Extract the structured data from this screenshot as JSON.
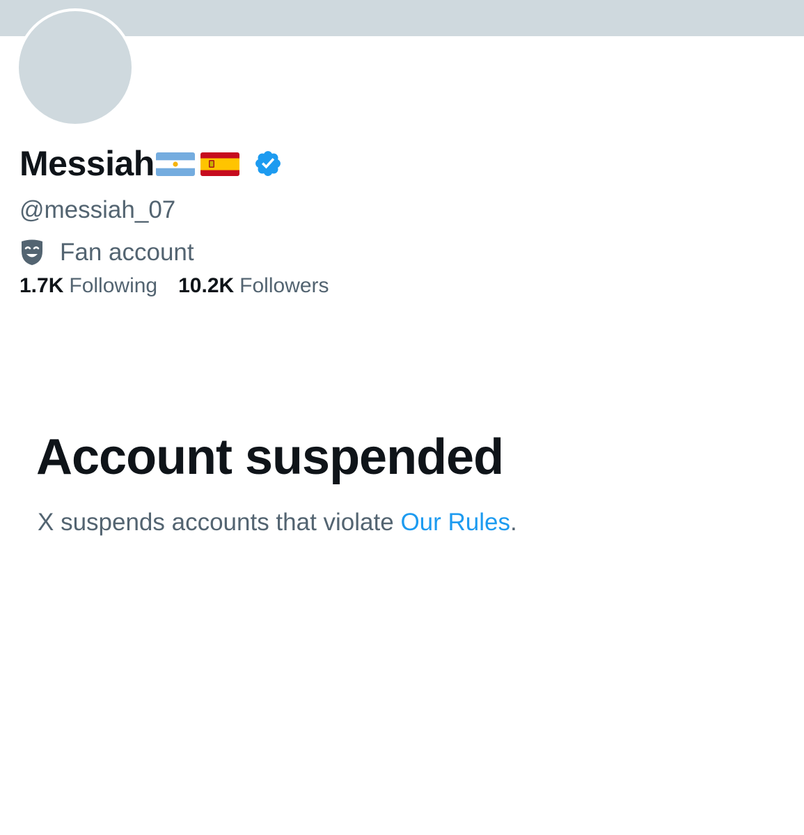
{
  "profile": {
    "display_name": "Messiah",
    "flags": [
      "argentina-flag",
      "spain-flag"
    ],
    "verified_icon": "verified-badge-icon",
    "handle": "@messiah_07",
    "category_icon": "theater-mask-icon",
    "category": "Fan account",
    "following_count": "1.7K",
    "following_label": "Following",
    "followers_count": "10.2K",
    "followers_label": "Followers"
  },
  "suspension": {
    "title": "Account suspended",
    "message_prefix": "X suspends accounts that violate ",
    "rules_link": "Our Rules",
    "message_suffix": "."
  },
  "colors": {
    "banner": "#cfd9de",
    "primary_text": "#0f1419",
    "secondary_text": "#536471",
    "link": "#1d9bf0",
    "verified": "#1d9bf0"
  }
}
